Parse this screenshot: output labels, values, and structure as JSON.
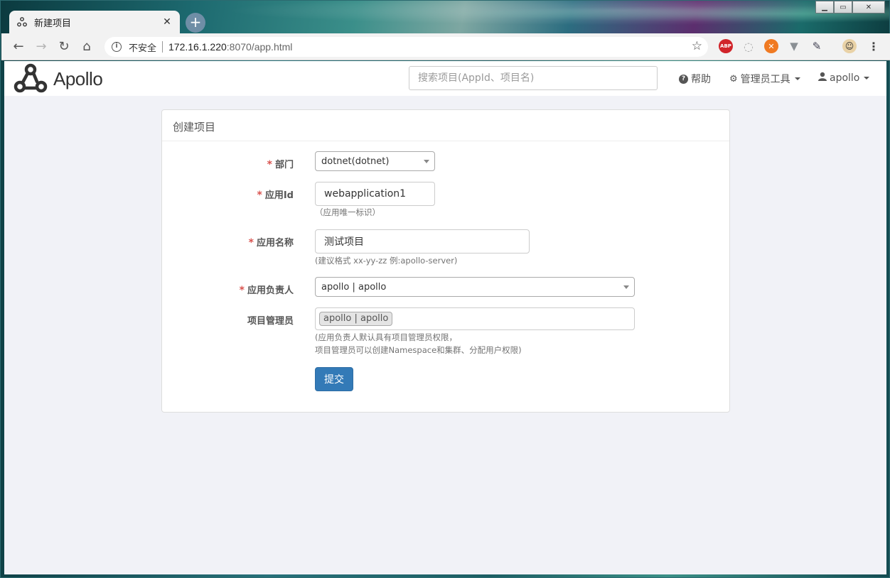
{
  "browser": {
    "tab_title": "新建项目",
    "tab_close": "✕",
    "new_tab": "+",
    "insecure_label": "不安全",
    "url_host": "172.16.1.220",
    "url_rest": ":8070/app.html",
    "ext_abp": "ABP",
    "window_controls": {
      "minimize": "▁",
      "maximize": "▭",
      "close": "✕"
    }
  },
  "navbar": {
    "logo_text": "Apollo",
    "search_placeholder": "搜索项目(AppId、项目名)",
    "help_label": "帮助",
    "admin_tools_label": "管理员工具",
    "user_label": "apollo"
  },
  "panel": {
    "title": "创建项目"
  },
  "form": {
    "required_mark": "*",
    "department": {
      "label": "部门",
      "value": "dotnet(dotnet)"
    },
    "app_id": {
      "label": "应用Id",
      "value": "webapplication1",
      "help": "（应用唯一标识）"
    },
    "app_name": {
      "label": "应用名称",
      "value": "测试项目",
      "help": "(建议格式 xx-yy-zz 例:apollo-server)"
    },
    "owner": {
      "label": "应用负责人",
      "value": "apollo | apollo"
    },
    "admins": {
      "label": "项目管理员",
      "tag": "apollo | apollo",
      "help_line1": "(应用负责人默认具有项目管理员权限，",
      "help_line2": "项目管理员可以创建Namespace和集群、分配用户权限)"
    },
    "submit_label": "提交"
  },
  "colors": {
    "primary_button": "#337ab7",
    "required": "#d9534f",
    "page_background": "#f1f2f7"
  }
}
